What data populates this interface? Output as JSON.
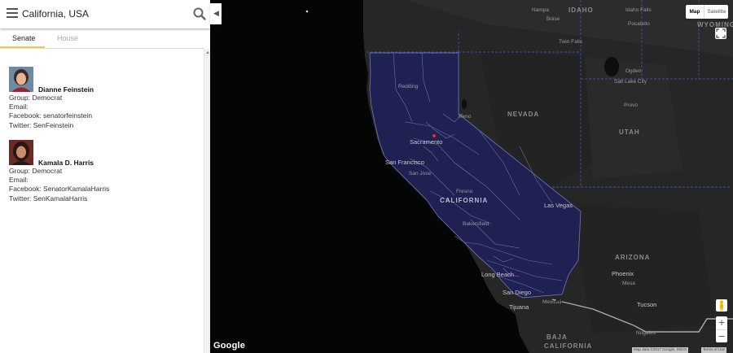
{
  "search": {
    "value": "California, USA"
  },
  "tabs": [
    {
      "label": "Senate",
      "active": true
    },
    {
      "label": "House",
      "active": false
    }
  ],
  "senators": [
    {
      "name": "Dianne Feinstein",
      "group": "Group: Democrat",
      "email": "Email:",
      "facebook": "Facebook: senatorfeinstein",
      "twitter": "Twitter: SenFeinstein"
    },
    {
      "name": "Kamala D. Harris",
      "group": "Group: Democrat",
      "email": "Email:",
      "facebook": "Facebook: SenatorKamalaHarris",
      "twitter": "Twitter: SenKamalaHarris"
    }
  ],
  "map": {
    "type_buttons": {
      "map": "Map",
      "satellite": "Satellite"
    },
    "states": {
      "idaho": "IDAHO",
      "wyoming": "WYOMING",
      "nevada": "NEVADA",
      "utah": "UTAH",
      "california": "CALIFORNIA",
      "arizona": "ARIZONA",
      "baja": "BAJA",
      "california_mx": "CALIFORNIA"
    },
    "cities": {
      "nampa": "Nampa",
      "boise": "Boise",
      "twin_falls": "Twin Falls",
      "idaho_falls": "Idaho Falls",
      "pocatello": "Pocatello",
      "redding": "Redding",
      "reno": "Reno",
      "sacramento": "Sacramento",
      "san_francisco": "San Francisco",
      "san_jose": "San Jose",
      "fresno": "Fresno",
      "bakersfield": "Bakersfield",
      "las_vegas": "Las Vegas",
      "ogden": "Ogden",
      "salt_lake_city": "Salt Lake City",
      "provo": "Provo",
      "phoenix": "Phoenix",
      "mesa": "Mesa",
      "tucson": "Tucson",
      "long_beach": "Long Beach",
      "san_diego": "San Diego",
      "tijuana": "Tijuana",
      "mexicali": "Mexicali",
      "nogales": "Nogales"
    },
    "attribution": "Map data ©2017 Google, INEGI",
    "terms": "Terms of Use",
    "logo": "Google",
    "colors": {
      "district_fill": "#1f2152",
      "district_border": "#6c6fa6",
      "state_border": "#3355aa",
      "marker": "#e5322d"
    }
  }
}
